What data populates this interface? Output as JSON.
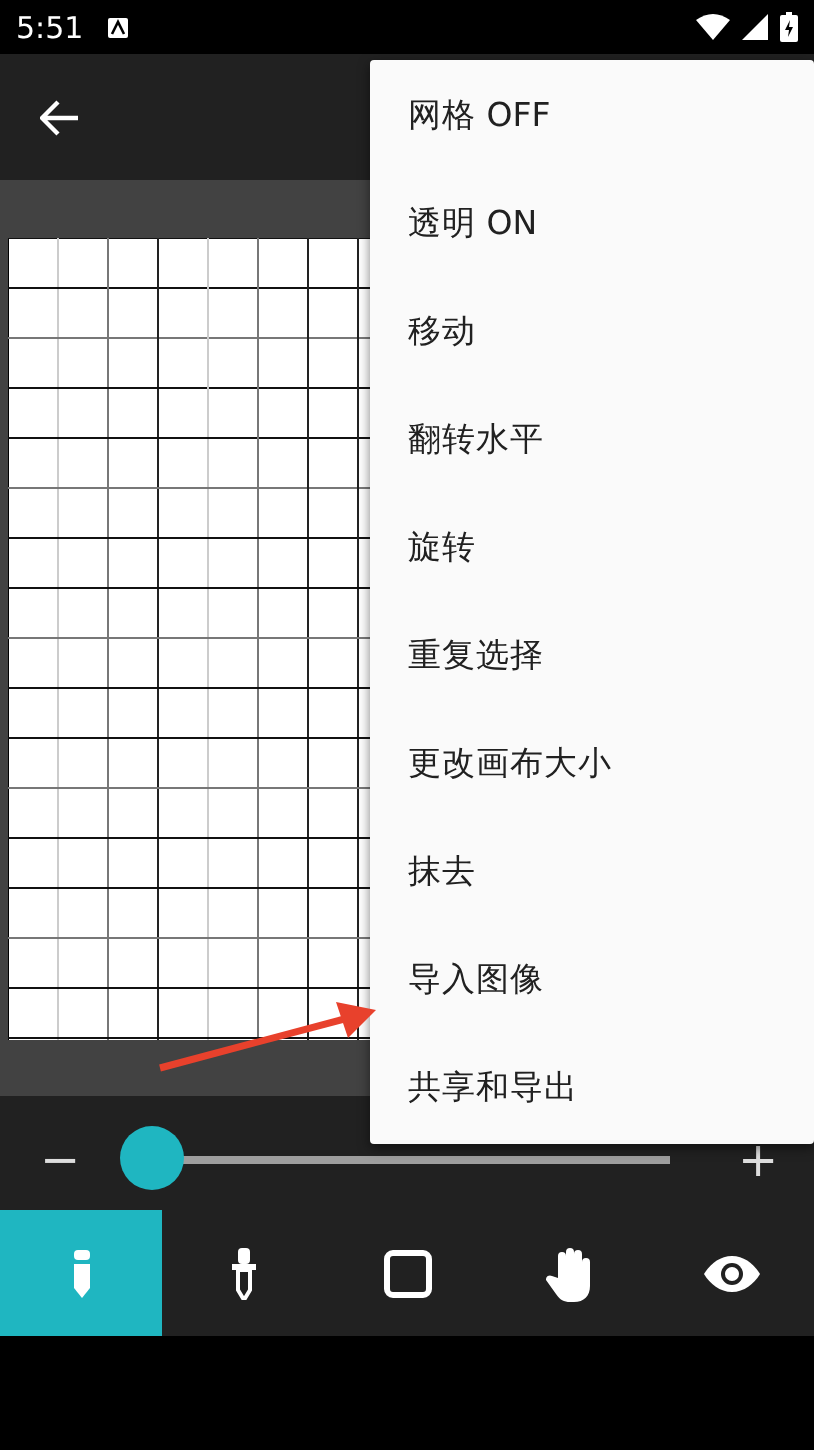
{
  "status_bar": {
    "time": "5:51"
  },
  "menu": {
    "items": [
      {
        "label": "网格 OFF"
      },
      {
        "label": "透明 ON"
      },
      {
        "label": "移动"
      },
      {
        "label": "翻转水平"
      },
      {
        "label": "旋转"
      },
      {
        "label": "重复选择"
      },
      {
        "label": "更改画布大小"
      },
      {
        "label": "抹去"
      },
      {
        "label": "导入图像"
      },
      {
        "label": "共享和导出"
      }
    ]
  },
  "zoom": {
    "minus": "−",
    "plus": "+",
    "level": 0
  },
  "tools": [
    {
      "kind": "pencil",
      "selected": true
    },
    {
      "kind": "dropper",
      "selected": false
    },
    {
      "kind": "square",
      "selected": false
    },
    {
      "kind": "hand",
      "selected": false
    },
    {
      "kind": "eye",
      "selected": false
    }
  ]
}
